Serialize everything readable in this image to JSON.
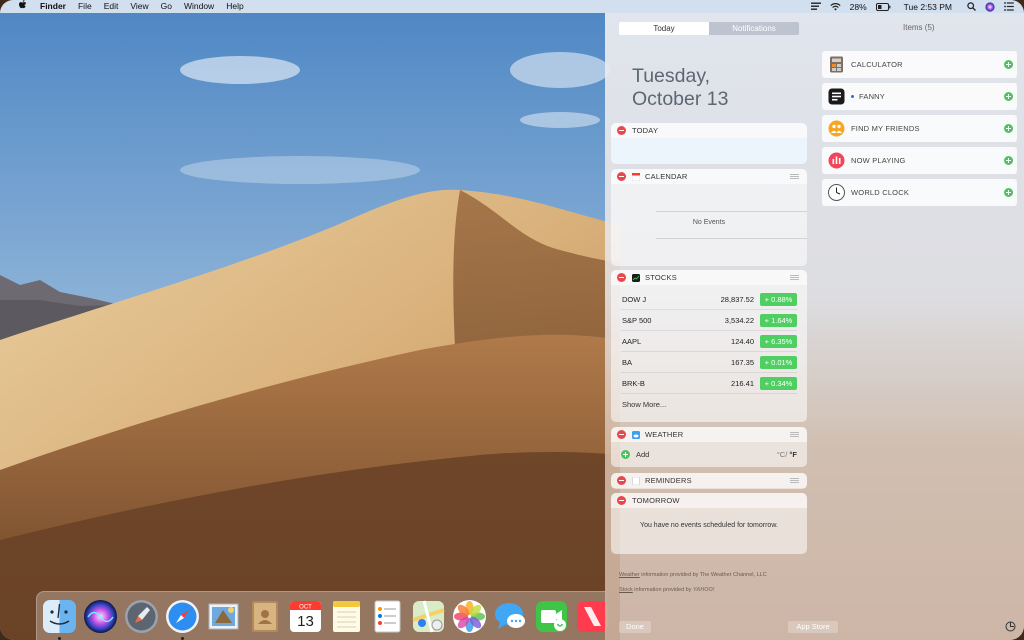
{
  "menubar": {
    "app_name": "Finder",
    "menus": [
      "File",
      "Edit",
      "View",
      "Go",
      "Window",
      "Help"
    ],
    "battery_percent": "28%",
    "clock": "Tue 2:53 PM"
  },
  "notification_center": {
    "tabs": {
      "today": "Today",
      "notifications": "Notifications"
    },
    "date_line1": "Tuesday,",
    "date_line2": "October 13",
    "widgets": {
      "today": {
        "title": "TODAY"
      },
      "calendar": {
        "title": "CALENDAR",
        "empty_text": "No Events"
      },
      "stocks": {
        "title": "STOCKS",
        "rows": [
          {
            "symbol": "DOW J",
            "price": "28,837.52",
            "change": "+ 0.88%"
          },
          {
            "symbol": "S&P 500",
            "price": "3,534.22",
            "change": "+ 1.64%"
          },
          {
            "symbol": "AAPL",
            "price": "124.40",
            "change": "+ 6.35%"
          },
          {
            "symbol": "BA",
            "price": "167.35",
            "change": "+ 0.01%"
          },
          {
            "symbol": "BRK-B",
            "price": "216.41",
            "change": "+ 0.34%"
          }
        ],
        "show_more": "Show More..."
      },
      "weather": {
        "title": "WEATHER",
        "add_label": "Add",
        "unit_c": "°C",
        "unit_sep": "/",
        "unit_f": "°F"
      },
      "reminders": {
        "title": "REMINDERS"
      },
      "tomorrow": {
        "title": "TOMORROW",
        "text": "You have no events scheduled for tomorrow."
      }
    },
    "items_title": "Items (5)",
    "items": [
      {
        "label": "CALCULATOR",
        "icon": "calculator-icon"
      },
      {
        "label": "FANNY",
        "icon": "fanny-icon"
      },
      {
        "label": "FIND MY FRIENDS",
        "icon": "find-my-friends-icon"
      },
      {
        "label": "NOW PLAYING",
        "icon": "now-playing-icon"
      },
      {
        "label": "WORLD CLOCK",
        "icon": "world-clock-icon"
      }
    ],
    "footer": {
      "weather_link": "Weather",
      "weather_text": "information provided by The Weather Channel, LLC",
      "stock_link": "Stock",
      "stock_text": "information provided by",
      "stock_brand": "YAHOO!"
    },
    "done_button": "Done",
    "app_store_button": "App Store"
  },
  "dock": {
    "apps": [
      "finder",
      "siri",
      "launchpad",
      "safari",
      "mail",
      "contacts",
      "calendar",
      "notes",
      "reminders",
      "maps",
      "photos",
      "messages",
      "facetime",
      "news"
    ],
    "calendar_month": "OCT",
    "calendar_day": "13"
  },
  "colors": {
    "remove_red": "#e5484d",
    "add_green": "#4cc45c",
    "stock_up": "#4fcf62"
  }
}
